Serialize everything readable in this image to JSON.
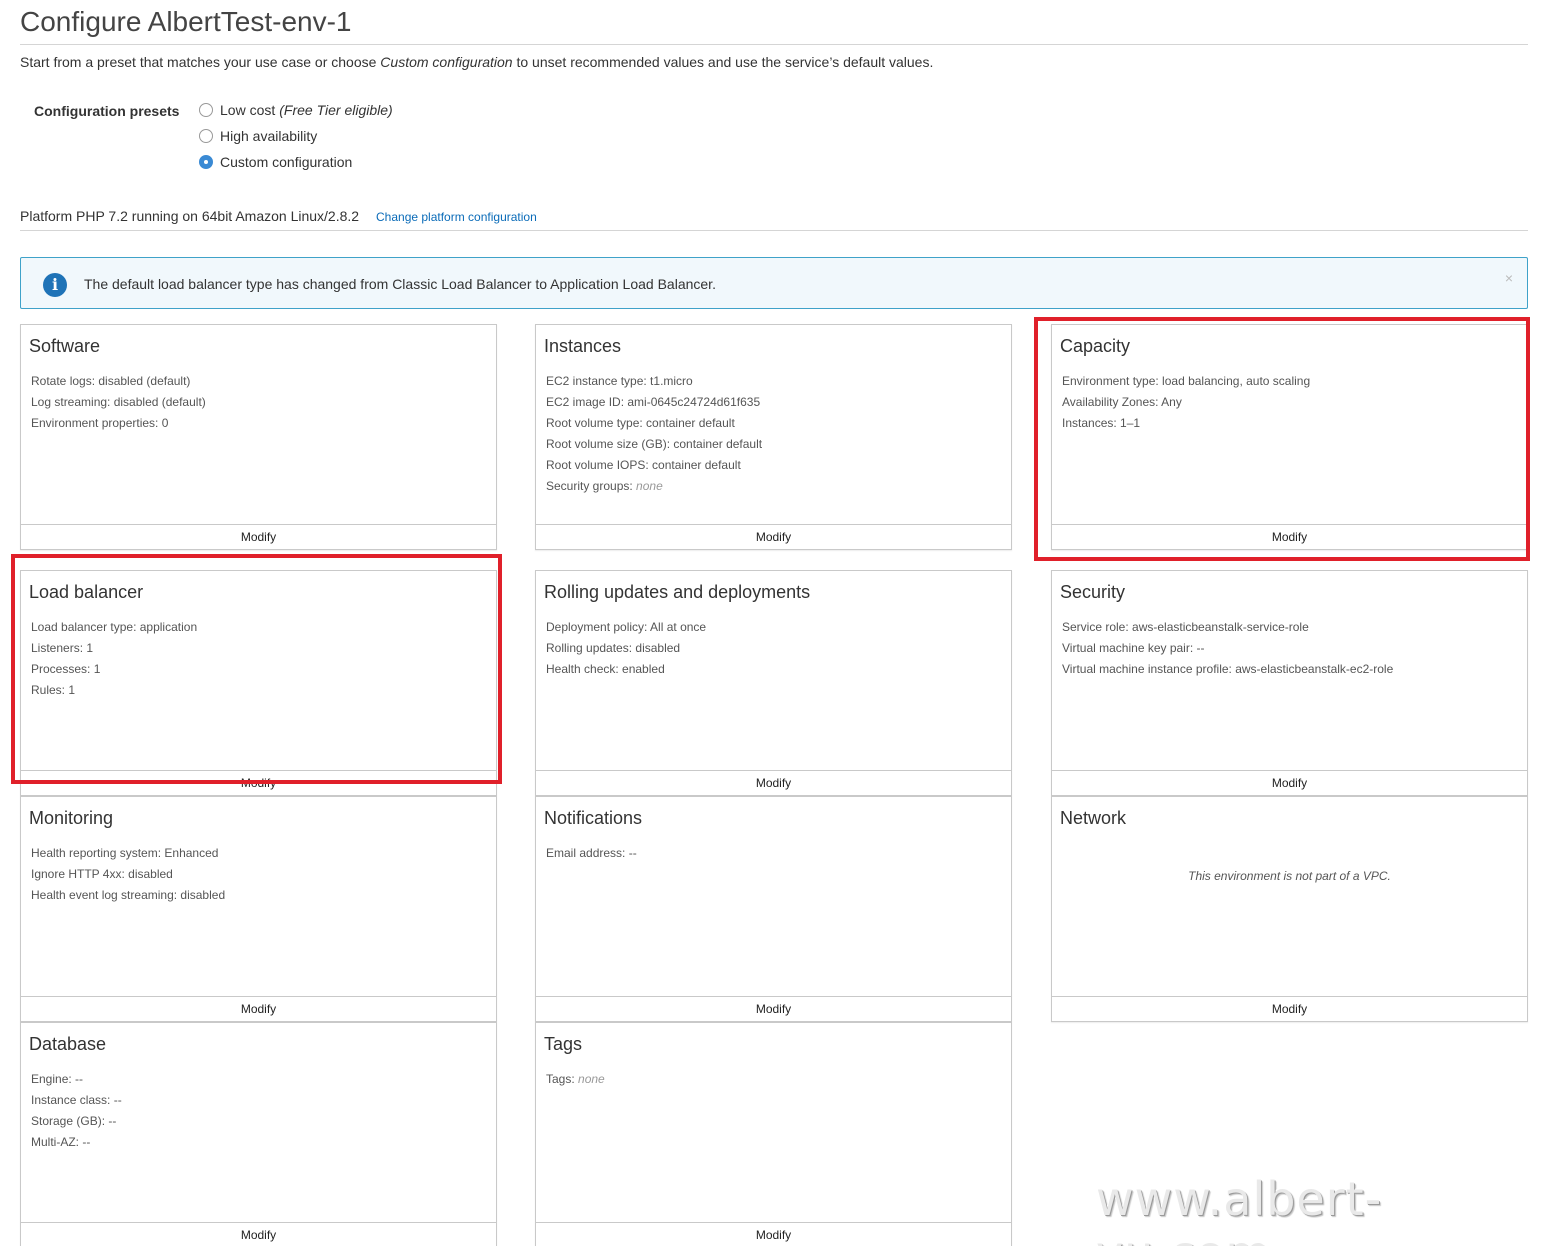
{
  "page": {
    "title": "Configure AlbertTest-env-1",
    "intro_before": "Start from a preset that matches your use case or choose",
    "intro_em": "Custom configuration",
    "intro_after": "to unset recommended values and use the service’s default values."
  },
  "presets": {
    "label": "Configuration presets",
    "options": [
      {
        "label": "Low cost",
        "note": "(Free Tier eligible)",
        "selected": false
      },
      {
        "label": "High availability",
        "note": "",
        "selected": false
      },
      {
        "label": "Custom configuration",
        "note": "",
        "selected": true
      }
    ]
  },
  "platform": {
    "text": "Platform PHP 7.2 running on 64bit Amazon Linux/2.8.2",
    "link": "Change platform configuration"
  },
  "alert": {
    "icon": "info-icon",
    "text": "The default load balancer type has changed from Classic Load Balancer to Application Load Balancer.",
    "close": "×"
  },
  "cards": [
    {
      "title": "Software",
      "lines": [
        "Rotate logs: disabled (default)",
        "Log streaming: disabled (default)",
        "Environment properties: 0"
      ],
      "modify": "Modify"
    },
    {
      "title": "Instances",
      "lines": [
        "EC2 instance type: t1.micro",
        "EC2 image ID: ami-0645c24724d61f635",
        "Root volume type: container default",
        "Root volume size (GB): container default",
        "Root volume IOPS: container default",
        "Security groups: "
      ],
      "security_groups_value": "none",
      "modify": "Modify"
    },
    {
      "title": "Capacity",
      "lines": [
        "Environment type: load balancing, auto scaling",
        "Availability Zones: Any",
        "Instances: 1–1"
      ],
      "modify": "Modify"
    },
    {
      "title": "Load balancer",
      "lines": [
        "Load balancer type: application",
        "Listeners: 1",
        "Processes: 1",
        "Rules: 1"
      ],
      "modify": "Modify"
    },
    {
      "title": "Rolling updates and deployments",
      "lines": [
        "Deployment policy: All at once",
        "Rolling updates: disabled",
        "Health check: enabled"
      ],
      "modify": "Modify"
    },
    {
      "title": "Security",
      "lines": [
        "Service role: aws-elasticbeanstalk-service-role",
        "Virtual machine key pair: --",
        "Virtual machine instance profile: aws-elasticbeanstalk-ec2-role"
      ],
      "modify": "Modify"
    },
    {
      "title": "Monitoring",
      "lines": [
        "Health reporting system: Enhanced",
        "Ignore HTTP 4xx: disabled",
        "Health event log streaming: disabled"
      ],
      "modify": "Modify"
    },
    {
      "title": "Notifications",
      "lines": [
        "Email address: --"
      ],
      "modify": "Modify"
    },
    {
      "title": "Network",
      "center": "This environment is not part of a VPC.",
      "modify": "Modify"
    },
    {
      "title": "Database",
      "lines": [
        "Engine: --",
        "Instance class: --",
        "Storage (GB): --",
        "Multi-AZ: --"
      ],
      "modify": "Modify"
    },
    {
      "title": "Tags",
      "lines": [
        "Tags: "
      ],
      "tags_value": "none",
      "modify": "Modify"
    }
  ],
  "highlight_color": "#e0202a",
  "watermark": "www.albert-yu.com"
}
